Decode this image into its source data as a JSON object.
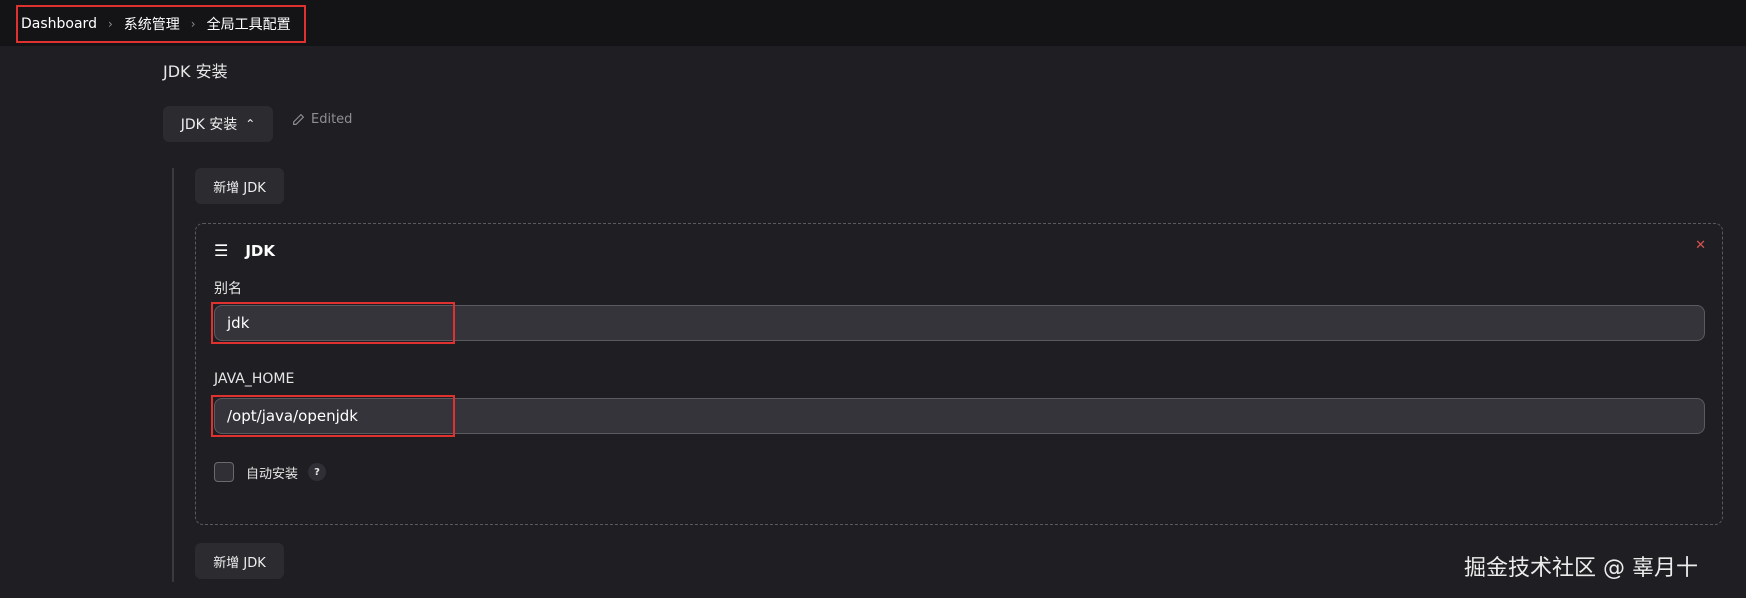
{
  "breadcrumb": {
    "items": [
      "Dashboard",
      "系统管理",
      "全局工具配置"
    ],
    "separator": ">"
  },
  "section": {
    "title": "JDK 安装",
    "toggle_label": "JDK 安装",
    "toggle_icon": "chevron-up-icon",
    "edited_label": "Edited",
    "edited_icon": "pencil-icon"
  },
  "add_jdk_label": "新增 JDK",
  "jdk_card": {
    "title": "JDK",
    "drag_icon": "menu-icon",
    "close_icon": "close-icon",
    "alias_label": "别名",
    "alias_value": "jdk",
    "java_home_label": "JAVA_HOME",
    "java_home_value": "/opt/java/openjdk",
    "auto_install_label": "自动安装",
    "auto_install_checked": false,
    "help_label": "?"
  },
  "watermark": "掘金技术社区 @ 辜月十",
  "colors": {
    "highlight": "#e03131",
    "close": "#d9534f",
    "background": "#1f1f23"
  }
}
